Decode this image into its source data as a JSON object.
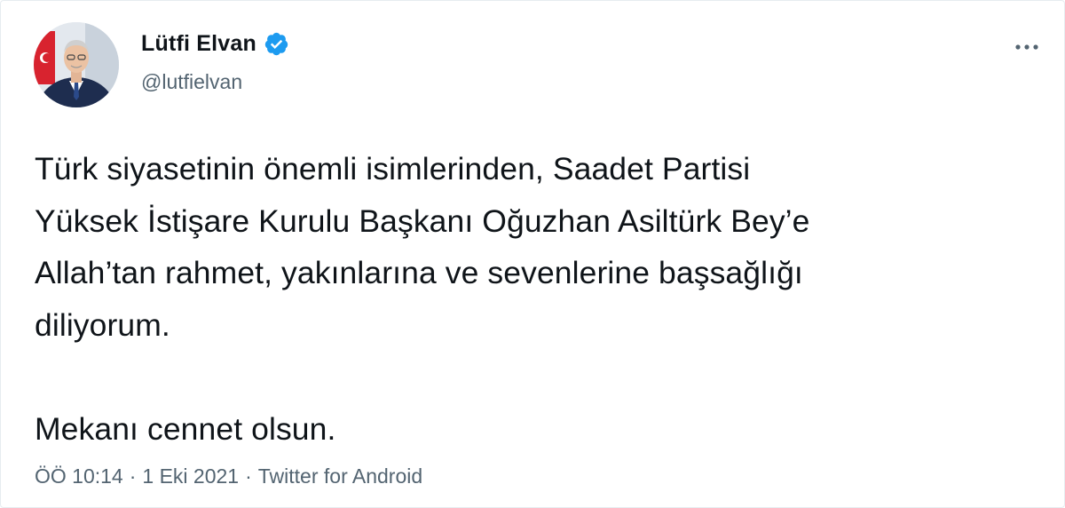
{
  "author": {
    "display_name": "Lütfi Elvan",
    "handle": "@lutfielvan",
    "verified": true
  },
  "tweet": {
    "lines": [
      "Türk siyasetinin önemli isimlerinden, Saadet Partisi",
      "Yüksek İstişare Kurulu Başkanı Oğuzhan Asiltürk Bey’e",
      "Allah’tan rahmet, yakınlarına ve sevenlerine başsağlığı",
      "diliyorum."
    ],
    "closing": "Mekanı cennet olsun."
  },
  "meta": {
    "time": "ÖÖ 10:14",
    "separator": "·",
    "date": "1 Eki 2021",
    "source": "Twitter for Android"
  },
  "icons": {
    "verified": "verified-badge-icon",
    "more": "more-options-icon"
  },
  "colors": {
    "verified_blue": "#1d9bf0",
    "text_primary": "#0f1419",
    "text_secondary": "#536471"
  }
}
